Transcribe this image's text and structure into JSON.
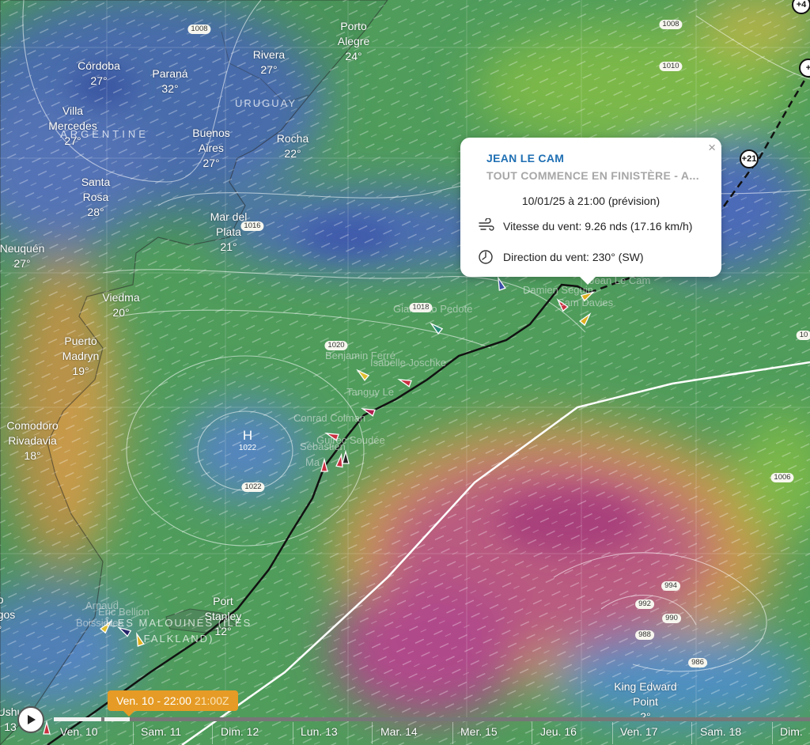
{
  "popup": {
    "skipper": "JEAN LE CAM",
    "team": "TOUT COMMENCE EN FINISTÈRE - A...",
    "datetime": "10/01/25 à 21:00 (prévision)",
    "wind_speed": "Vitesse du vent: 9.26 nds (17.16 km/h)",
    "wind_direction": "Direction du vent: 230° (SW)",
    "close_label": "×"
  },
  "cities": [
    {
      "name": "Córdoba\n27°"
    },
    {
      "name": "Paraná\n32°"
    },
    {
      "name": "Rivera\n27°"
    },
    {
      "name": "Porto\nAlegre\n24°"
    },
    {
      "name": "Villa\nMercedes\n27°"
    },
    {
      "name": "Buenos\nAires\n27°"
    },
    {
      "name": "Rocha\n22°"
    },
    {
      "name": "Santa\nRosa\n28°"
    },
    {
      "name": "Mar del\nPlata\n21°"
    },
    {
      "name": "Neuquén\n27°"
    },
    {
      "name": "Viedma\n20°"
    },
    {
      "name": "Puerto\nMadryn\n19°"
    },
    {
      "name": "Comodoro\nRivadavia\n18°"
    },
    {
      "name": "Port\nStanley\n12°"
    },
    {
      "name": "King Edward\nPoint\n2°"
    },
    {
      "name": "o\ngos\n°"
    },
    {
      "name": "Ushu\n13"
    }
  ],
  "regions": [
    "URUGUAY",
    "ARGENTINE",
    "ÎLES MALOUINES (ÎLES\nFALKLAND)"
  ],
  "isobars": [
    "1008",
    "1008",
    "1010",
    "1016",
    "1018",
    "1020",
    "1022",
    "1006",
    "994",
    "992",
    "990",
    "988",
    "986",
    "10"
  ],
  "pressure_center": {
    "label": "H",
    "value": "1022"
  },
  "skipper_labels": [
    "Giancarlo Pedote",
    "Benjamin Ferré",
    "Isabelle Joschke",
    "Tanguy Le",
    "Conrad Colman",
    "Guirec Soudée",
    "Sébastien",
    "Ma",
    "Jean Le Cam",
    "Damien Seguin",
    "Sam Davies",
    "Arnaud",
    "Éric Bellion",
    "Boissières"
  ],
  "forecast_markers": [
    "+21",
    "+4",
    "+"
  ],
  "timeline": {
    "current": "Ven. 10 - 22:00",
    "utc": "21:00Z",
    "days": [
      "Ven. 10",
      "Sam. 11",
      "Dim. 12",
      "Lun. 13",
      "Mar. 14",
      "Mer. 15",
      "Jeu. 16",
      "Ven. 17",
      "Sam. 18",
      "Dim."
    ],
    "progress": 0.1
  },
  "colors": {
    "popup_title": "#1f6fb3",
    "time_badge": "#e59b25",
    "ocean_green": "#4a9a5a",
    "low_pressure_magenta": "#b04a8a"
  }
}
